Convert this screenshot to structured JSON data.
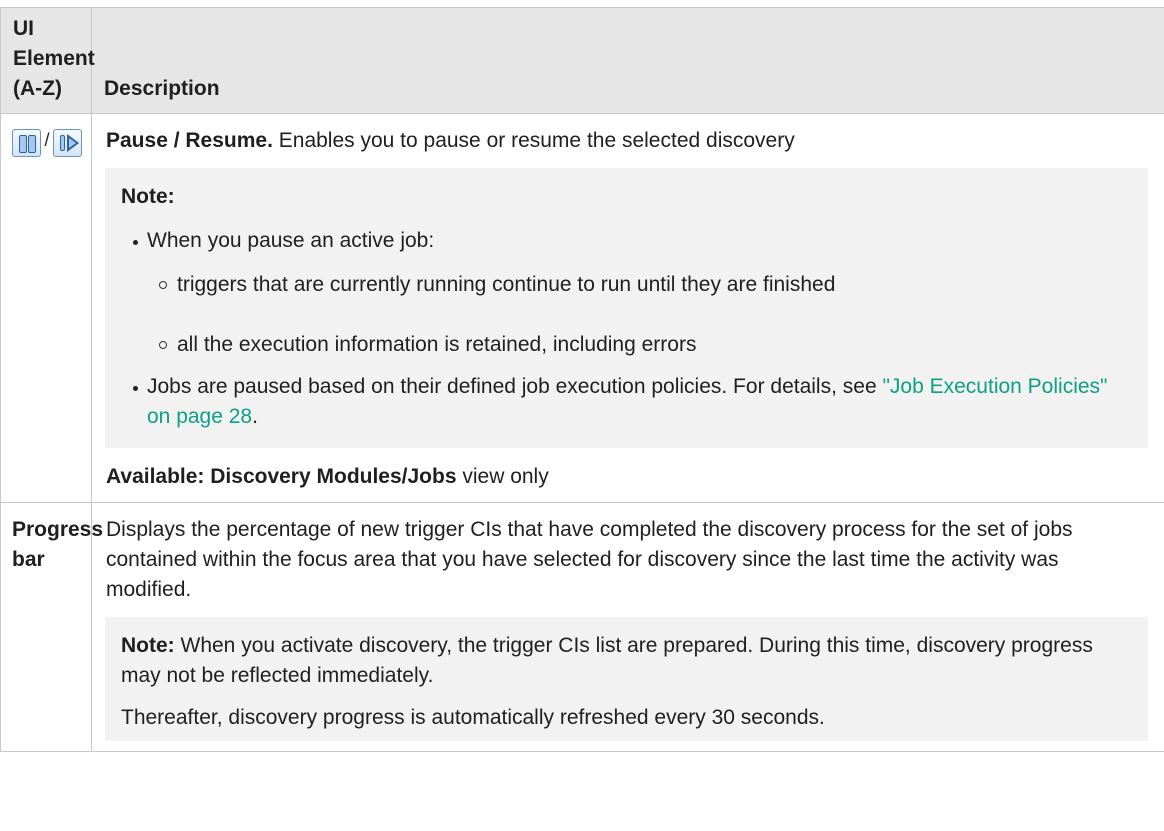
{
  "headers": {
    "col1": "UI Element (A-Z)",
    "col2": "Description"
  },
  "rows": [
    {
      "element_icons": {
        "pause": "pause-icon",
        "separator": "/",
        "resume": "resume-icon"
      },
      "title": "Pause / Resume.",
      "text": " Enables you to pause or resume the selected discovery",
      "note": {
        "title": "Note:",
        "bullet1": "When you pause an active job:",
        "sub1": "triggers that are currently running continue to run until they are finished",
        "sub2": "all the execution information is retained, including errors",
        "bullet2": "Jobs are paused based on their defined job execution policies. For details, see ",
        "link": "\"Job Execution Policies\" on page 28",
        "link_suffix": "."
      },
      "available_label": "Available: ",
      "available_bold": "Discovery Modules/Jobs",
      "available_text": " view only"
    },
    {
      "element": "Progress bar",
      "text": "Displays the percentage of new trigger CIs that have completed the discovery process for the set of jobs contained within the focus area that you have selected for discovery since the last time the activity was modified.",
      "note": {
        "title": "Note:",
        "text": " When you activate discovery, the trigger CIs list are prepared. During this time, discovery progress may not be reflected immediately.",
        "text2": "Thereafter, discovery progress is automatically refreshed every 30 seconds."
      }
    }
  ],
  "colors": {
    "link": "#0ea085",
    "header_bg": "#e6e6e6",
    "note_bg": "#f2f2f2"
  }
}
